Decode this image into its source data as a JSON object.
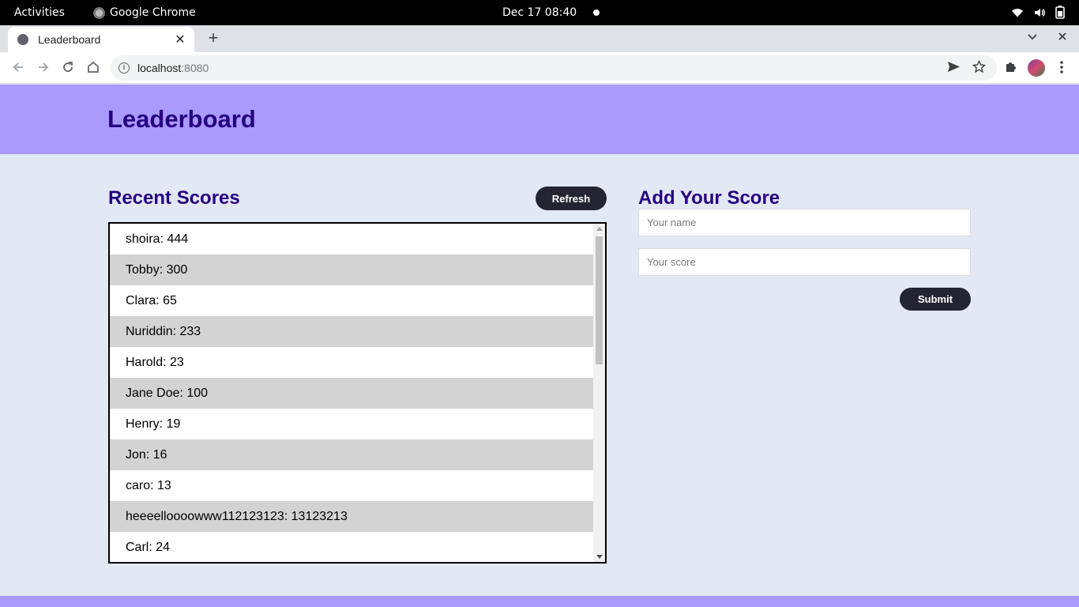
{
  "system_bar": {
    "activities": "Activities",
    "app_name": "Google Chrome",
    "clock": "Dec 17  08:40"
  },
  "browser": {
    "tab_title": "Leaderboard",
    "tab_close": "✕",
    "new_tab": "+",
    "url_host": "localhost",
    "url_port": ":8080"
  },
  "page": {
    "title": "Leaderboard",
    "recent_scores_title": "Recent Scores",
    "refresh_label": "Refresh",
    "add_score_title": "Add Your Score",
    "name_placeholder": "Your name",
    "score_placeholder": "Your score",
    "submit_label": "Submit",
    "scores": [
      "shoira: 444",
      "Tobby: 300",
      "Clara: 65",
      "Nuriddin: 233",
      "Harold: 23",
      "Jane Doe: 100",
      "Henry: 19",
      "Jon: 16",
      "caro: 13",
      "heeeelloooowww112123123: 13123213",
      "Carl: 24"
    ]
  },
  "colors": {
    "header_bg": "#a99afb",
    "title_color": "#270082",
    "page_bg": "#e2e8f4",
    "button_bg": "#232532"
  }
}
